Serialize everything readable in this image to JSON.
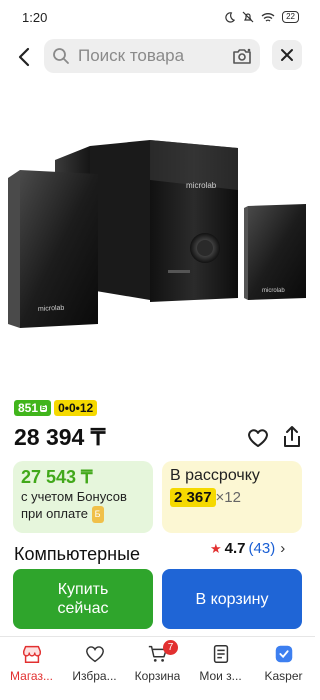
{
  "status_bar": {
    "time": "1:20",
    "battery": "22"
  },
  "header": {
    "search_placeholder": "Поиск товара"
  },
  "product": {
    "brand_on_device": "microlab",
    "badge_green": "851",
    "badge_green_mark": "Б",
    "badge_yellow": "0•0•12",
    "price": "28 394 ₸",
    "title": "Компьютерные",
    "rating": "4.7",
    "reviews": "(43)"
  },
  "bonus_card": {
    "amount": "27 543 ₸",
    "line1": "с учетом Бонусов",
    "line2": "при оплате",
    "coin": "Б"
  },
  "installment_card": {
    "title": "В рассрочку",
    "amount": "2 367",
    "multiplier": "×12"
  },
  "actions": {
    "buy_now": "Купить сейчас",
    "add_to_cart": "В корзину"
  },
  "bottom_nav": {
    "items": [
      {
        "label": "Магаз...",
        "icon": "store-icon"
      },
      {
        "label": "Избра...",
        "icon": "heart-icon"
      },
      {
        "label": "Корзина",
        "icon": "cart-icon"
      },
      {
        "label": "Мои з...",
        "icon": "orders-icon"
      },
      {
        "label": "Kasper",
        "icon": "kaspersky-icon"
      }
    ],
    "cart_count": "7"
  },
  "colors": {
    "green": "#2fa52c",
    "blue": "#1f65d6",
    "red": "#e23030",
    "yellow": "#f5d900"
  }
}
